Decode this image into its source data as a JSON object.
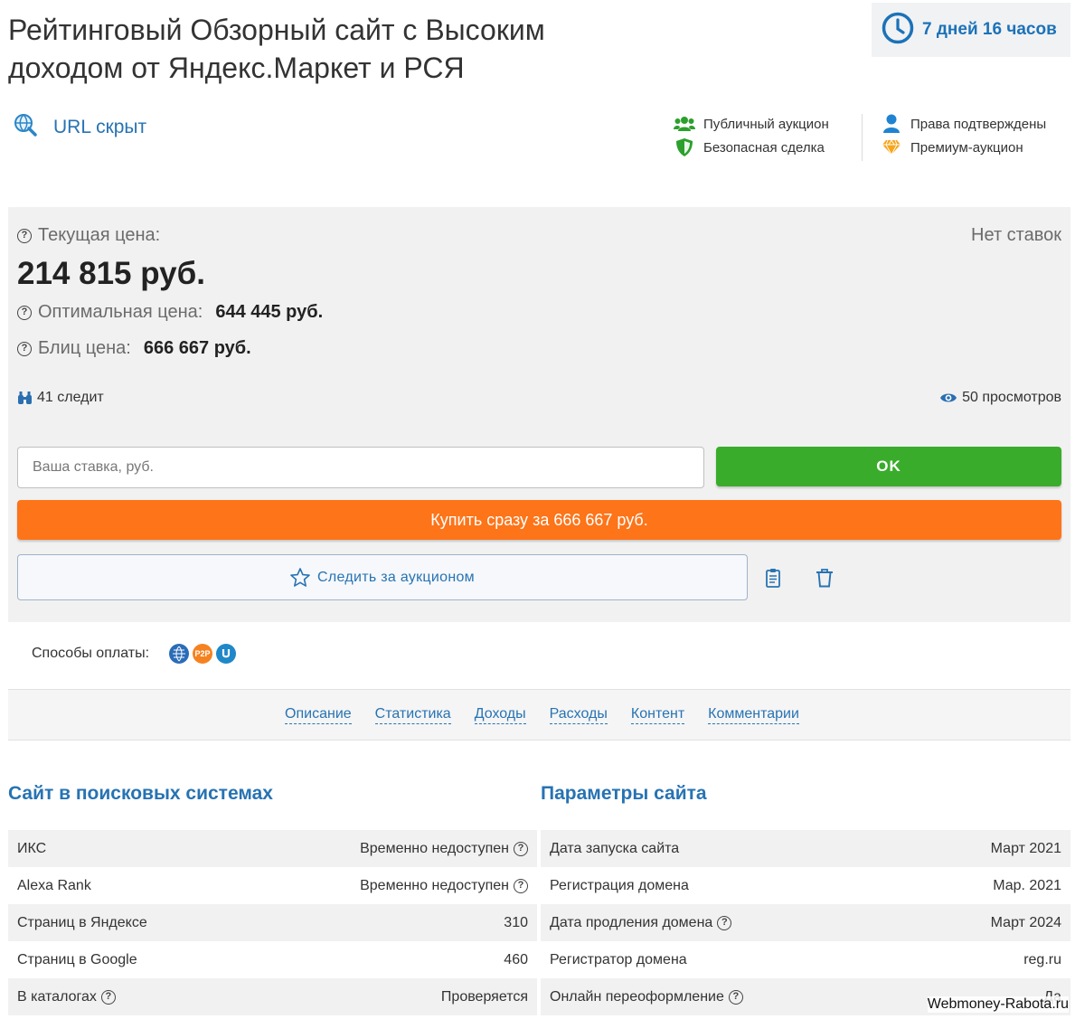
{
  "header": {
    "title": "Рейтинговый Обзорный сайт с Высоким доходом от Яндекс.Маркет и РСЯ",
    "timer": "7 дней 16 часов"
  },
  "site": {
    "url_label": "URL скрыт"
  },
  "badges": {
    "public_auction": "Публичный аукцион",
    "safe_deal": "Безопасная сделка",
    "rights_confirmed": "Права подтверждены",
    "premium_auction": "Премиум-аукцион"
  },
  "price": {
    "current_label": "Текущая цена:",
    "current_value": "214 815 руб.",
    "no_bids": "Нет ставок",
    "optimal_label": "Оптимальная цена:",
    "optimal_value": "644 445 руб.",
    "blitz_label": "Блиц цена:",
    "blitz_value": "666 667 руб."
  },
  "stats": {
    "watchers": "41 следит",
    "views": "50 просмотров"
  },
  "bid": {
    "placeholder": "Ваша ставка, руб.",
    "ok_label": "OK",
    "buy_now_label": "Купить сразу за 666 667 руб.",
    "watch_label": "Следить за аукционом"
  },
  "payment": {
    "label": "Способы оплаты:",
    "icons": [
      "webmoney-icon",
      "p2p-icon",
      "umoney-icon"
    ]
  },
  "tabs": [
    {
      "label": "Описание"
    },
    {
      "label": "Статистика"
    },
    {
      "label": "Доходы"
    },
    {
      "label": "Расходы"
    },
    {
      "label": "Контент"
    },
    {
      "label": "Комментарии"
    }
  ],
  "search_section": {
    "title": "Сайт в поисковых системах",
    "rows": [
      {
        "key": "ИКС",
        "value": "Временно недоступен"
      },
      {
        "key": "Alexa Rank",
        "value": "Временно недоступен"
      },
      {
        "key": "Страниц в Яндексе",
        "value": "310"
      },
      {
        "key": "Страниц в Google",
        "value": "460"
      },
      {
        "key": "В каталогах",
        "value": "Проверяется"
      }
    ]
  },
  "params_section": {
    "title": "Параметры сайта",
    "rows": [
      {
        "key": "Дата запуска сайта",
        "value": "Март 2021"
      },
      {
        "key": "Регистрация домена",
        "value": "Мар. 2021"
      },
      {
        "key": "Дата продления домена",
        "value": "Март 2024"
      },
      {
        "key": "Регистратор домена",
        "value": "reg.ru"
      },
      {
        "key": "Онлайн переоформление",
        "value": "Да"
      }
    ]
  },
  "watermark": "Webmoney-Rabota.ru",
  "colors": {
    "link": "#2773b3",
    "ok": "#3aac2b",
    "buy": "#fd7419",
    "panel": "#f1f1f1"
  }
}
